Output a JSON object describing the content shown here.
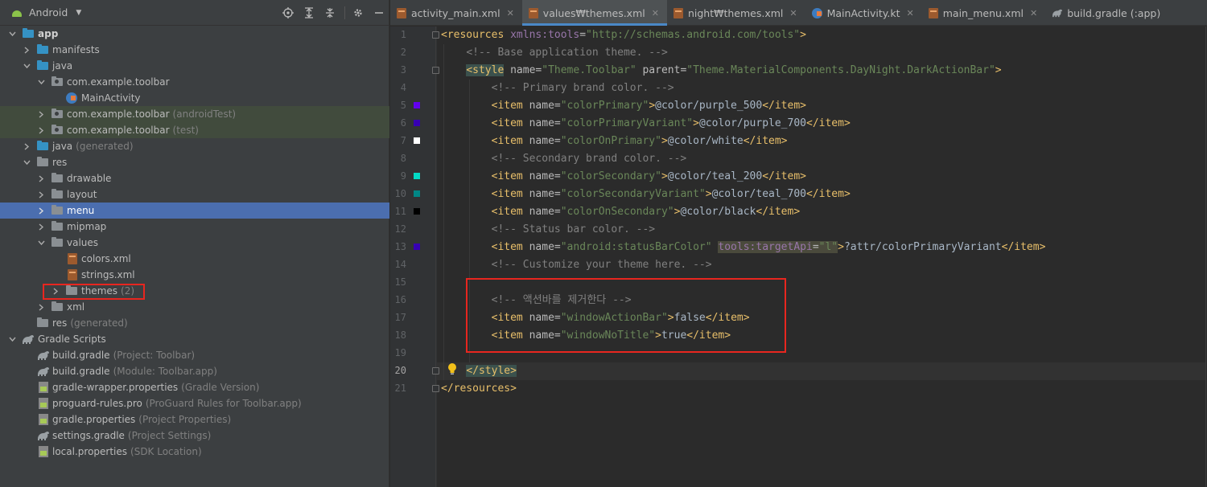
{
  "project": {
    "view_title": "Android",
    "tree": [
      {
        "label": "app",
        "bold": true
      },
      {
        "label": "manifests"
      },
      {
        "label": "java"
      },
      {
        "label": "com.example.toolbar"
      },
      {
        "label": "MainActivity"
      },
      {
        "label": "com.example.toolbar",
        "suffix": "(androidTest)"
      },
      {
        "label": "com.example.toolbar",
        "suffix": "(test)"
      },
      {
        "label": "java",
        "suffix": "(generated)"
      },
      {
        "label": "res"
      },
      {
        "label": "drawable"
      },
      {
        "label": "layout"
      },
      {
        "label": "menu"
      },
      {
        "label": "mipmap"
      },
      {
        "label": "values"
      },
      {
        "label": "colors.xml"
      },
      {
        "label": "strings.xml"
      },
      {
        "label": "themes",
        "suffix": "(2)"
      },
      {
        "label": "xml"
      },
      {
        "label": "res",
        "suffix": "(generated)"
      },
      {
        "label": "Gradle Scripts"
      },
      {
        "label": "build.gradle",
        "suffix": "(Project: Toolbar)"
      },
      {
        "label": "build.gradle",
        "suffix": "(Module: Toolbar.app)"
      },
      {
        "label": "gradle-wrapper.properties",
        "suffix": "(Gradle Version)"
      },
      {
        "label": "proguard-rules.pro",
        "suffix": "(ProGuard Rules for Toolbar.app)"
      },
      {
        "label": "gradle.properties",
        "suffix": "(Project Properties)"
      },
      {
        "label": "settings.gradle",
        "suffix": "(Project Settings)"
      },
      {
        "label": "local.properties",
        "suffix": "(SDK Location)"
      }
    ]
  },
  "tabs": [
    {
      "label": "activity_main.xml"
    },
    {
      "label": "values₩themes.xml",
      "active": true
    },
    {
      "label": "night₩themes.xml"
    },
    {
      "label": "MainActivity.kt"
    },
    {
      "label": "main_menu.xml"
    },
    {
      "label": "build.gradle (:app)"
    }
  ],
  "editor": {
    "current_line": 20,
    "line_numbers": [
      "1",
      "2",
      "3",
      "4",
      "5",
      "6",
      "7",
      "8",
      "9",
      "10",
      "11",
      "12",
      "13",
      "14",
      "15",
      "16",
      "17",
      "18",
      "19",
      "20",
      "21"
    ],
    "comments": {
      "l2": "<!-- Base application theme. -->",
      "l4": "<!-- Primary brand color. -->",
      "l8": "<!-- Secondary brand color. -->",
      "l12": "<!-- Status bar color. -->",
      "l14": "<!-- Customize your theme here. -->",
      "l16": "<!-- 액션바를 제거한다 -->"
    },
    "items": {
      "l5": {
        "name": "\"colorPrimary\"",
        "value": "@color/purple_500"
      },
      "l6": {
        "name": "\"colorPrimaryVariant\"",
        "value": "@color/purple_700"
      },
      "l7": {
        "name": "\"colorOnPrimary\"",
        "value": "@color/white"
      },
      "l9": {
        "name": "\"colorSecondary\"",
        "value": "@color/teal_200"
      },
      "l10": {
        "name": "\"colorSecondaryVariant\"",
        "value": "@color/teal_700"
      },
      "l11": {
        "name": "\"colorOnSecondary\"",
        "value": "@color/black"
      },
      "l13": {
        "name": "\"android:statusBarColor\"",
        "value": "?attr/colorPrimaryVariant"
      },
      "l17": {
        "name": "\"windowActionBar\"",
        "value": "false"
      },
      "l18": {
        "name": "\"windowNoTitle\"",
        "value": "true"
      }
    },
    "resources_open": {
      "tag": "resources",
      "ns_attr": "xmlns:tools",
      "ns_val": "\"http://schemas.android.com/tools\""
    },
    "style_open": {
      "tag": "style",
      "name_val": "\"Theme.Toolbar\"",
      "parent_val": "\"Theme.MaterialComponents.DayNight.DarkActionBar\""
    },
    "target_api": {
      "attr": "tools:targetApi",
      "val": "\"l\""
    },
    "style_close": "</style>",
    "resources_close": "</resources>",
    "swatches": {
      "l5": "#6200ee",
      "l6": "#3700b3",
      "l7": "#ffffff",
      "l9": "#03dac5",
      "l10": "#018786",
      "l11": "#000000",
      "l13": "#3700b3"
    }
  }
}
